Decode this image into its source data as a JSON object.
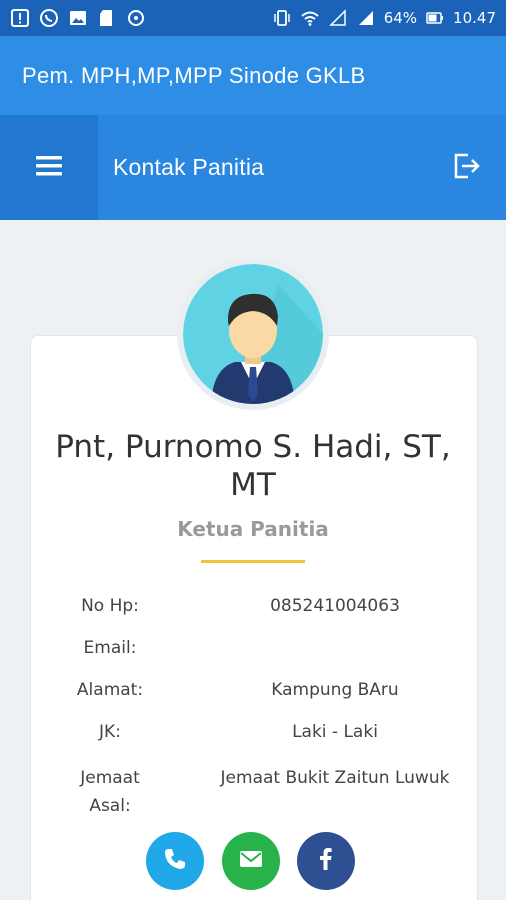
{
  "status_bar": {
    "battery_percent": "64%",
    "time": "10.47",
    "left_icons": [
      "notification-icon",
      "whatsapp-icon",
      "gallery-icon",
      "sd-card-icon",
      "chat-icon"
    ],
    "right_icons": [
      "vibrate-icon",
      "wifi-icon",
      "signal-icon",
      "signal-2-icon",
      "battery-icon"
    ]
  },
  "app_bar": {
    "title": "Pem. MPH,MP,MPP Sinode GKLB"
  },
  "toolbar": {
    "page_title": "Kontak Panitia",
    "menu_icon": "hamburger-icon",
    "logout_icon": "logout-icon"
  },
  "profile": {
    "name": "Pnt, Purnomo S. Hadi, ST, MT",
    "role": "Ketua Panitia",
    "divider_color": "#f0c43a",
    "details": [
      {
        "label": "No Hp:",
        "value": "085241004063"
      },
      {
        "label": "Email:",
        "value": ""
      },
      {
        "label": "Alamat:",
        "value": "Kampung BAru"
      },
      {
        "label": "JK:",
        "value": "Laki - Laki"
      },
      {
        "label": "Jemaat Asal:",
        "value": "Jemaat Bukit Zaitun Luwuk"
      }
    ]
  },
  "actions": [
    {
      "name": "phone",
      "icon": "phone-icon",
      "color": "#21a8e8"
    },
    {
      "name": "email",
      "icon": "mail-icon",
      "color": "#27b24a"
    },
    {
      "name": "facebook",
      "icon": "facebook-icon",
      "color": "#2f4f93"
    }
  ],
  "colors": {
    "status_bar": "#1a63b8",
    "app_bar": "#2e8ee6",
    "toolbar": "#2a86df",
    "menu_button": "#2277cf",
    "background": "#eef1f4"
  }
}
